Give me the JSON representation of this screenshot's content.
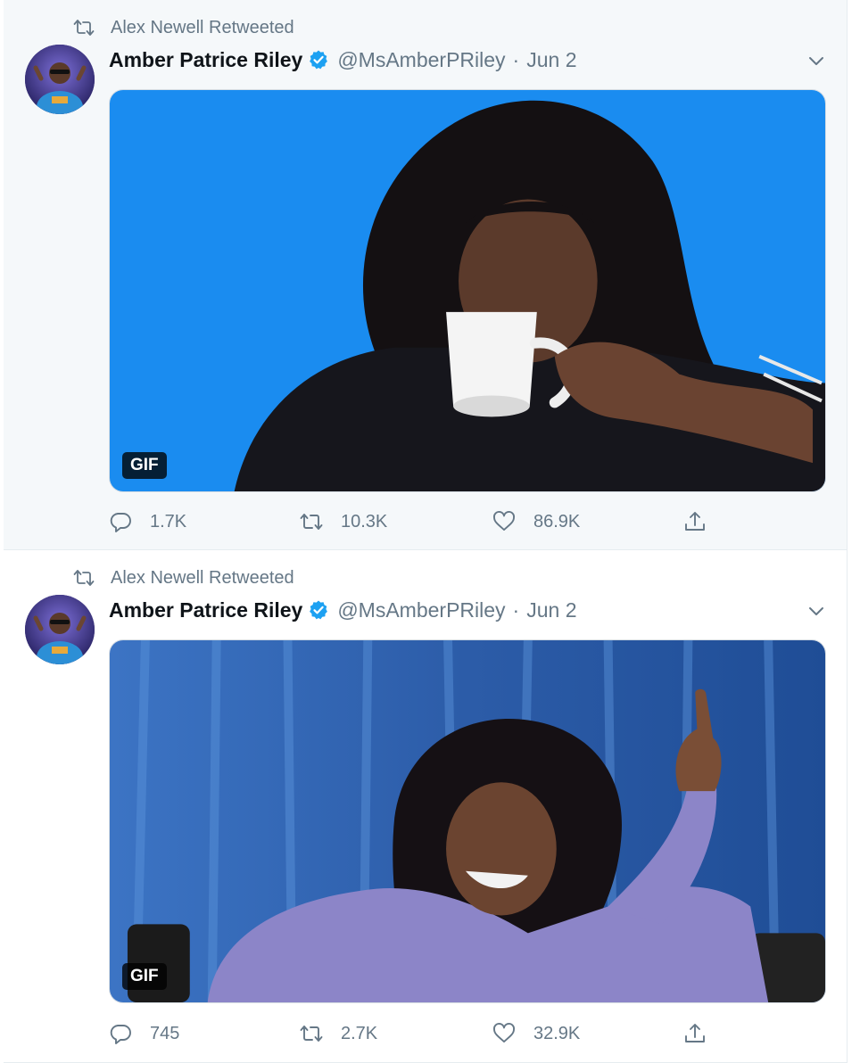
{
  "tweets": [
    {
      "retweeted_by": "Alex Newell Retweeted",
      "author_name": "Amber Patrice Riley",
      "handle": "@MsAmberPRiley",
      "separator": "·",
      "date": "Jun 2",
      "media_badge": "GIF",
      "media_background": "#1a8cf0",
      "replies": "1.7K",
      "retweets": "10.3K",
      "likes": "86.9K"
    },
    {
      "retweeted_by": "Alex Newell Retweeted",
      "author_name": "Amber Patrice Riley",
      "handle": "@MsAmberPRiley",
      "separator": "·",
      "date": "Jun 2",
      "media_badge": "GIF",
      "media_background": "#2f5fae",
      "replies": "745",
      "retweets": "2.7K",
      "likes": "32.9K"
    }
  ],
  "icons": {
    "retweeted": "retweet-icon",
    "verified": "verified-badge-icon",
    "caret": "chevron-down-icon",
    "reply": "reply-icon",
    "retweet": "retweet-icon",
    "like": "heart-icon",
    "share": "share-icon"
  },
  "colors": {
    "verified": "#1da1f2",
    "muted": "#657786",
    "name": "#0f1419"
  }
}
